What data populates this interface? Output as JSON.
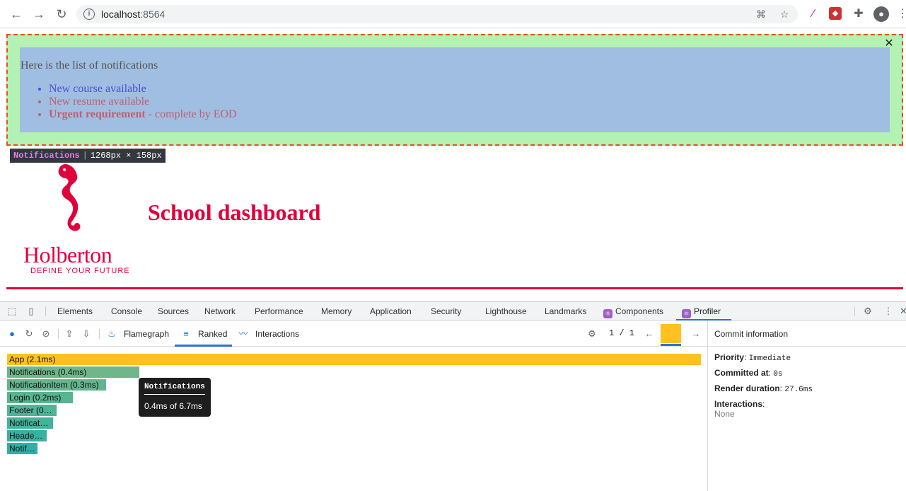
{
  "browser": {
    "url_host": "localhost",
    "url_port": ":8564"
  },
  "notifications": {
    "header": "Here is the list of notifications",
    "items": [
      {
        "text": "New course available"
      },
      {
        "text": "New resume available"
      }
    ],
    "urgent_strong": "Urgent requirement",
    "urgent_rest": " - complete by EOD",
    "close_glyph": "✕"
  },
  "inspect_label": {
    "component": "Notifications",
    "size": "1268px × 158px"
  },
  "logo": {
    "wordmark": "Holberton",
    "tagline": "DEFINE YOUR FUTURE"
  },
  "page": {
    "title": "School dashboard"
  },
  "colors": {
    "brand": "#e0003c",
    "notif_default": "#4d4de6",
    "notif_urgent": "#c06070"
  },
  "devtools": {
    "tabs": [
      "Elements",
      "Console",
      "Sources",
      "Network",
      "Performance",
      "Memory",
      "Application",
      "Security",
      "Lighthouse",
      "Landmarks",
      "Components",
      "Profiler"
    ],
    "active_tab": "Profiler"
  },
  "profiler": {
    "views": {
      "flamegraph": "Flamegraph",
      "ranked": "Ranked",
      "interactions": "Interactions"
    },
    "active_view": "Ranked",
    "commit_counter": "1 / 1"
  },
  "chart_data": {
    "type": "bar",
    "title": "",
    "unit": "ms",
    "categories": [
      "App",
      "Notifications",
      "NotificationItem",
      "Login",
      "Footer",
      "NotificationItemShape",
      "Header",
      "NotificationItem"
    ],
    "values": [
      2.1,
      0.4,
      0.3,
      0.2,
      0.15,
      0.14,
      0.12,
      0.09
    ],
    "labels": [
      "App (2.1ms)",
      "Notifications (0.4ms)",
      "NotificationItem (0.3ms)",
      "Login (0.2ms)",
      "Footer (0…",
      "Notificat…",
      "Heade…",
      "Notif…"
    ],
    "colors": [
      "#ffc120",
      "#6fb78a",
      "#63b58e",
      "#58b592",
      "#4fb496",
      "#43b39b",
      "#37b2a0",
      "#2cb1a4"
    ],
    "xlim": [
      0,
      2.1
    ]
  },
  "hover_tooltip": {
    "title": "Notifications",
    "body": "0.4ms of 6.7ms"
  },
  "commit_info": {
    "header": "Commit information",
    "priority_label": "Priority",
    "priority_value": "Immediate",
    "committed_label": "Committed at",
    "committed_value": "0s",
    "render_label": "Render duration",
    "render_value": "27.6ms",
    "interactions_label": "Interactions",
    "interactions_value": "None"
  }
}
